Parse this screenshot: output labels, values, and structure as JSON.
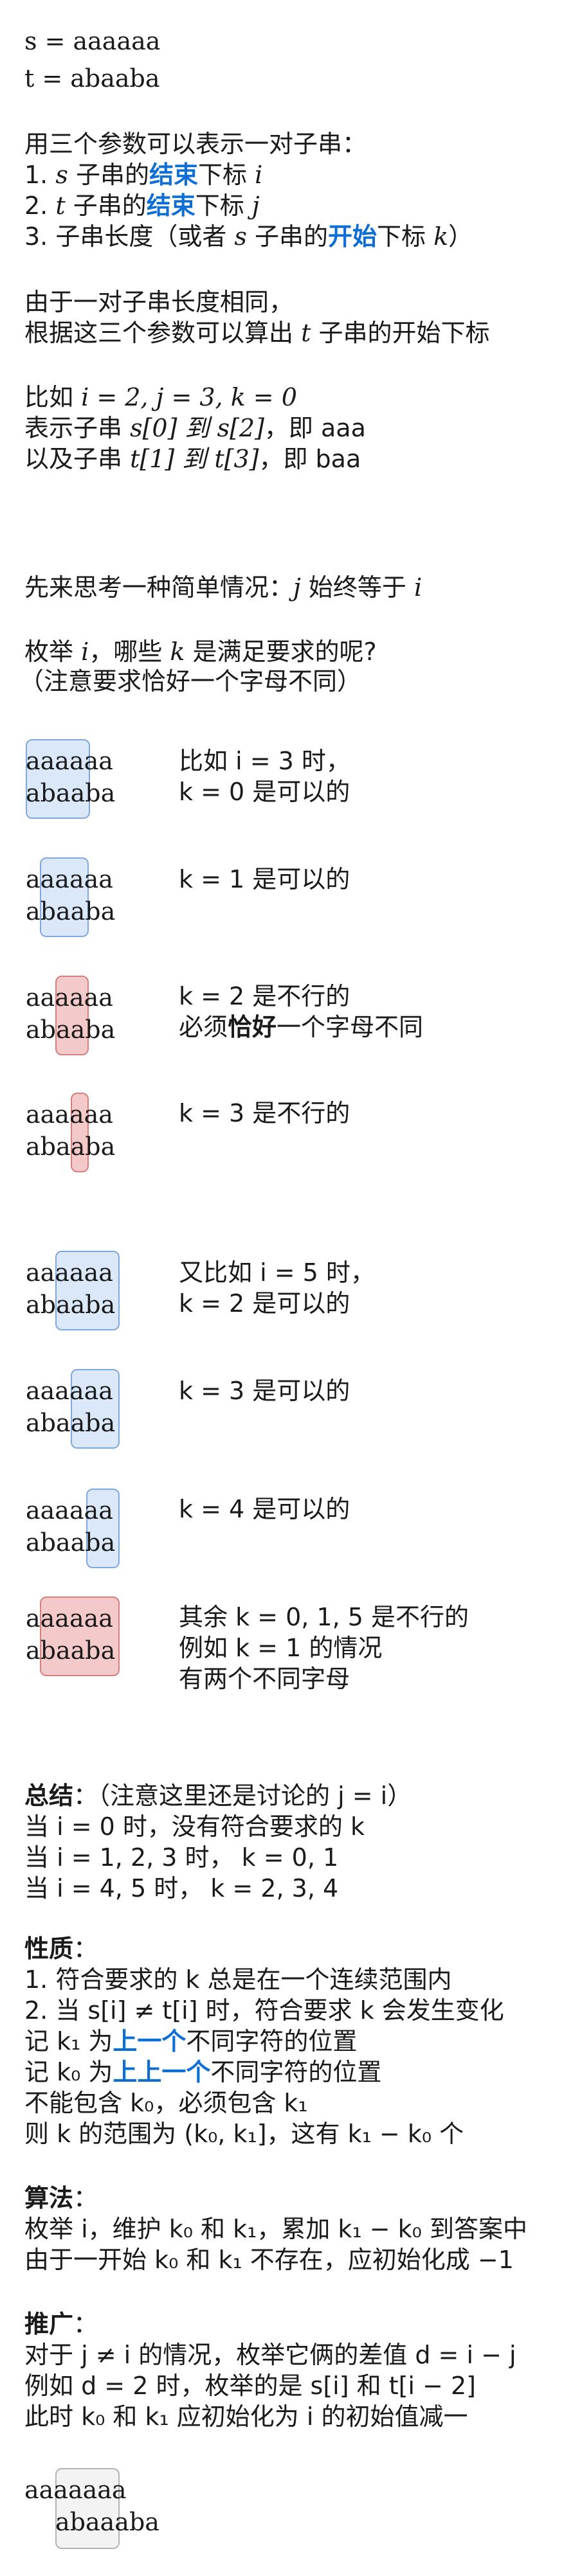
{
  "intro": {
    "s_line": "s = aaaaaa",
    "t_line": "t = abaaba"
  },
  "params": {
    "heading": "用三个参数可以表示一对子串：",
    "item1_pre": "1. ",
    "item1_var": "s",
    "item1_mid": " 子串的",
    "item1_hl": "结束",
    "item1_post": "下标 ",
    "item1_idx": "i",
    "item2_pre": "2. ",
    "item2_var": "t",
    "item2_mid": " 子串的",
    "item2_hl": "结束",
    "item2_post": "下标 ",
    "item2_idx": "j",
    "item3_pre": "3. 子串长度（或者 ",
    "item3_var": "s",
    "item3_mid": " 子串的",
    "item3_hl": "开始",
    "item3_post": "下标 ",
    "item3_idx": "k",
    "item3_end": "）"
  },
  "reason": {
    "line1": "由于一对子串长度相同，",
    "line2_pre": "根据这三个参数可以算出 ",
    "line2_var": "t",
    "line2_post": " 子串的开始下标"
  },
  "example": {
    "line1_pre": "比如 ",
    "line1_math": "i = 2, j = 3, k = 0",
    "line2_pre": "表示子串 ",
    "line2_math": "s[0] 到 s[2]",
    "line2_post": "，即 aaa",
    "line3_pre": "以及子串  ",
    "line3_math": "t[1] 到 t[3]",
    "line3_post": "，即 baa"
  },
  "simple": {
    "line1_pre": "先来思考一种简单情况：",
    "line1_math": "j",
    "line1_post": " 始终等于 ",
    "line1_var": "i",
    "line2_pre": "枚举 ",
    "line2_var": "i",
    "line2_mid": "，哪些 ",
    "line2_var2": "k",
    "line2_post": " 是满足要求的呢?",
    "line3": "（注意要求恰好一个字母不同）"
  },
  "cases": [
    {
      "s": "aaaaaa",
      "t": "abaaba",
      "desc1": "比如 i = 3 时，",
      "desc2": "k = 0 是可以的"
    },
    {
      "s": "aaaaaa",
      "t": "abaaba",
      "desc1": "k = 1 是可以的",
      "desc2": ""
    },
    {
      "s": "aaaaaa",
      "t": "abaaba",
      "desc1": "k = 2 是不行的",
      "desc2_pre": "必须",
      "desc2_bold": "恰好",
      "desc2_post": "一个字母不同"
    },
    {
      "s": "aaaaaa",
      "t": "abaaba",
      "desc1": "k = 3 是不行的",
      "desc2": ""
    },
    {
      "s": "aaaaaa",
      "t": "abaaba",
      "desc1": "又比如 i = 5 时，",
      "desc2": "k = 2 是可以的"
    },
    {
      "s": "aaaaaa",
      "t": "abaaba",
      "desc1": "k = 3 是可以的",
      "desc2": ""
    },
    {
      "s": "aaaaaa",
      "t": "abaaba",
      "desc1": "k = 4 是可以的",
      "desc2": ""
    },
    {
      "s": "aaaaaa",
      "t": "abaaba",
      "desc1": "其余 k = 0, 1, 5 是不行的",
      "desc2": "例如 k = 1 的情况",
      "desc3": "有两个不同字母"
    }
  ],
  "summary": {
    "title": "总结",
    "title_post": "：（注意这里还是讨论的 j = i）",
    "l1": "当 i = 0 时，没有符合要求的 k",
    "l2": "当 i = 1, 2, 3 时， k = 0, 1",
    "l3": "当 i = 4, 5 时， k = 2, 3, 4"
  },
  "property": {
    "title": "性质",
    "title_post": "：",
    "l1": "1. 符合要求的 k 总是在一个连续范围内",
    "l2": "2. 当 s[i] ≠ t[i] 时，符合要求 k 会发生变化",
    "l3_pre": "记 k₁ 为",
    "l3_hl": "上一个",
    "l3_post": "不同字符的位置",
    "l4_pre": "记 k₀ 为",
    "l4_hl": "上上一个",
    "l4_post": "不同字符的位置",
    "l5": "不能包含 k₀，必须包含 k₁",
    "l6": "则 k 的范围为 (k₀, k₁]，这有 k₁ − k₀ 个"
  },
  "algorithm": {
    "title": "算法",
    "title_post": "：",
    "l1": "枚举 i，维护 k₀ 和 k₁，累加 k₁ − k₀ 到答案中",
    "l2": "由于一开始 k₀ 和 k₁ 不存在，应初始化成 −1"
  },
  "generalize": {
    "title": "推广",
    "title_post": "：",
    "l1": "对于 j ≠ i 的情况，枚举它俩的差值 d = i − j",
    "l2": "例如 d = 2 时，枚举的是 s[i] 和 t[i − 2]",
    "l3": "此时 k₀ 和 k₁ 应初始化为 i 的初始值减一"
  },
  "final": {
    "s": "aaaaaaa",
    "t": "abaaaba"
  },
  "colors": {
    "highlight": "#0d6fd6",
    "ok_fill": "#dbe8f9",
    "bad_fill": "#f4c9c9",
    "neutral_fill": "#f3f3f3"
  }
}
